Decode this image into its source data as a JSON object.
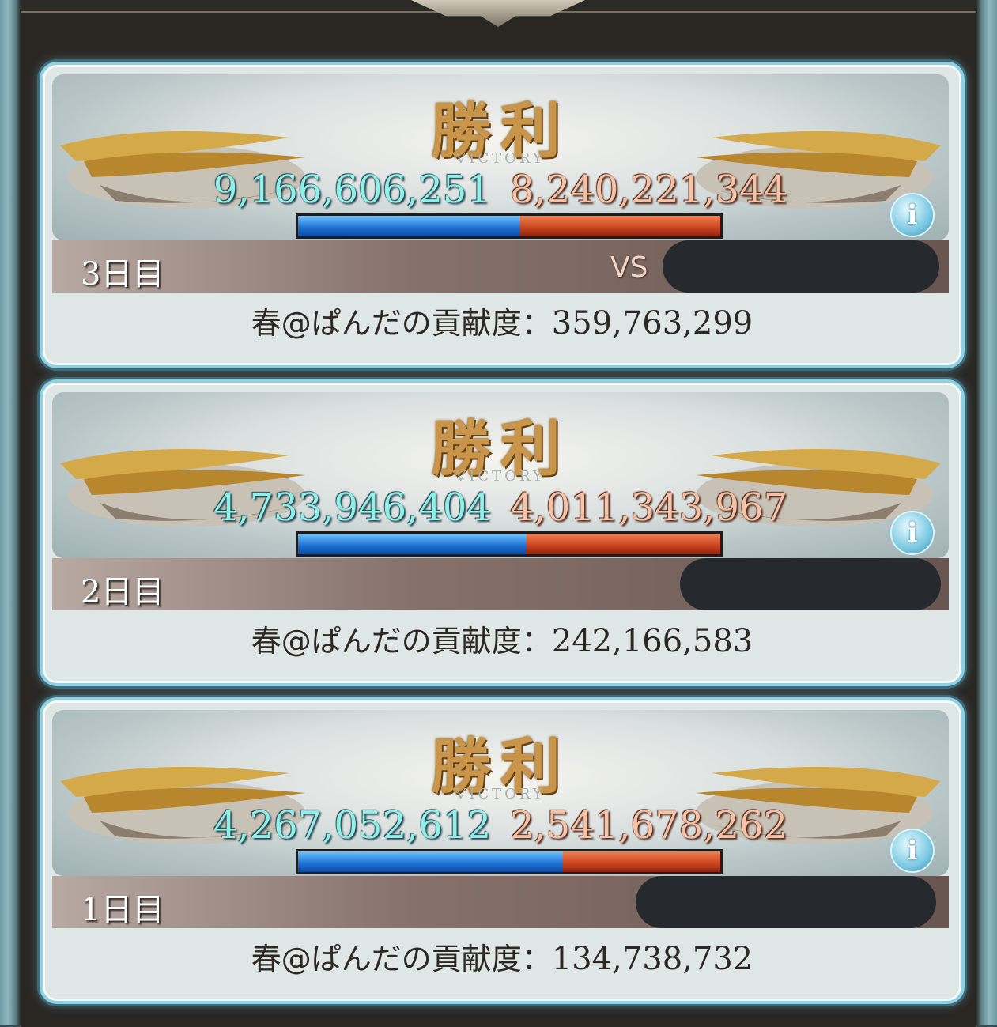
{
  "results": [
    {
      "victory_label": "勝利",
      "victory_sub": "VICTORY",
      "score_own": "9,166,606,251",
      "score_opponent": "8,240,221,344",
      "own_share": 0.527,
      "day_label": "3日目",
      "vs_label": "VS",
      "contribution_label": "春@ぱんだの貢献度：",
      "contribution_value": "359,763,299"
    },
    {
      "victory_label": "勝利",
      "victory_sub": "VICTORY",
      "score_own": "4,733,946,404",
      "score_opponent": "4,011,343,967",
      "own_share": 0.541,
      "day_label": "2日目",
      "vs_label": "",
      "contribution_label": "春@ぱんだの貢献度：",
      "contribution_value": "242,166,583"
    },
    {
      "victory_label": "勝利",
      "victory_sub": "VICTORY",
      "score_own": "4,267,052,612",
      "score_opponent": "2,541,678,262",
      "own_share": 0.627,
      "day_label": "1日目",
      "vs_label": "",
      "contribution_label": "春@ぱんだの貢献度：",
      "contribution_value": "134,738,732"
    }
  ],
  "icons": {
    "info": "info-icon",
    "ship": "airship-icon"
  },
  "colors": {
    "own_bar": "#1c6fd1",
    "opponent_bar": "#c9411e",
    "card_border": "#8fd0e2"
  }
}
